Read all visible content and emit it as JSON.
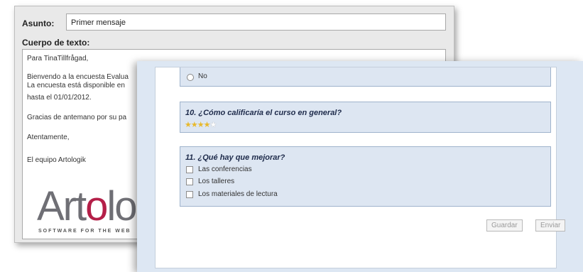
{
  "email": {
    "subject_label": "Asunto:",
    "subject_value": "Primer mensaje",
    "body_label": "Cuerpo de texto:",
    "lines": [
      "Para TinaTillfrågad,",
      "Bienvendo a la encuesta Evalua",
      "La encuesta está disponible en",
      " hasta el 01/01/2012.",
      "Gracias de antemano por su pa",
      "Atentamente,",
      "El equipo Artologik"
    ],
    "logo": {
      "text_a": "Art",
      "text_o": "o",
      "text_b": "lo",
      "tagline": "SOFTWARE FOR THE WEB"
    }
  },
  "survey": {
    "q9": {
      "option": "No"
    },
    "q10": {
      "title": "10. ¿Cómo calificaría el curso en general?",
      "rating": 4,
      "max": 5
    },
    "q11": {
      "title": "11. ¿Qué hay que mejorar?",
      "options": [
        "Las conferencias",
        "Los talleres",
        "Los materiales de lectura"
      ]
    },
    "buttons": {
      "save": "Guardar",
      "send": "Enviar"
    }
  },
  "colors": {
    "accent": "#b41f48",
    "panel": "#dde6f2",
    "star": "#e8b92c"
  }
}
